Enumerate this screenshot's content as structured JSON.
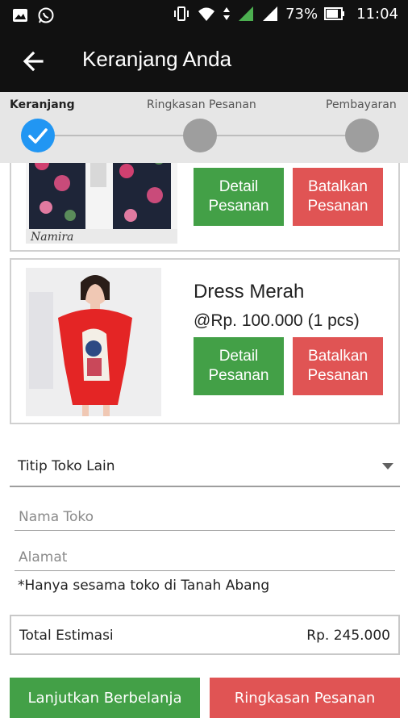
{
  "status_bar": {
    "battery_percent": "73%",
    "time": "11:04",
    "icons": [
      "image-notification-icon",
      "whatsapp-icon",
      "vibrate-icon",
      "wifi-icon",
      "data-arrows-icon",
      "signal-icon",
      "signal-icon-2",
      "battery-icon"
    ]
  },
  "app_bar": {
    "title": "Keranjang Anda",
    "back_icon": "arrow-left-icon"
  },
  "stepper": {
    "steps": [
      {
        "label": "Keranjang",
        "state": "done"
      },
      {
        "label": "Ringkasan Pesanan",
        "state": "pending"
      },
      {
        "label": "Pembayaran",
        "state": "pending"
      }
    ],
    "colors": {
      "done": "#2196f3",
      "pending": "#9e9e9e"
    }
  },
  "cart_items": [
    {
      "image_caption": "Namira",
      "detail_label": "Detail Pesanan",
      "cancel_label": "Batalkan Pesanan"
    },
    {
      "name": "Dress Merah",
      "price": "@Rp. 100.000 (1 pcs)",
      "detail_label": "Detail Pesanan",
      "cancel_label": "Batalkan Pesanan"
    }
  ],
  "form": {
    "select_value": "Titip Toko Lain",
    "store_name_placeholder": "Nama Toko",
    "address_placeholder": "Alamat",
    "note": "*Hanya sesama toko di Tanah Abang"
  },
  "total": {
    "label": "Total Estimasi",
    "value": "Rp. 245.000"
  },
  "actions": {
    "continue_label": "Lanjutkan Berbelanja",
    "summary_label": "Ringkasan Pesanan"
  },
  "colors": {
    "green": "#43a047",
    "red": "#e05454",
    "app_bar": "#111111",
    "stepper_bg": "#e6e6e6"
  }
}
